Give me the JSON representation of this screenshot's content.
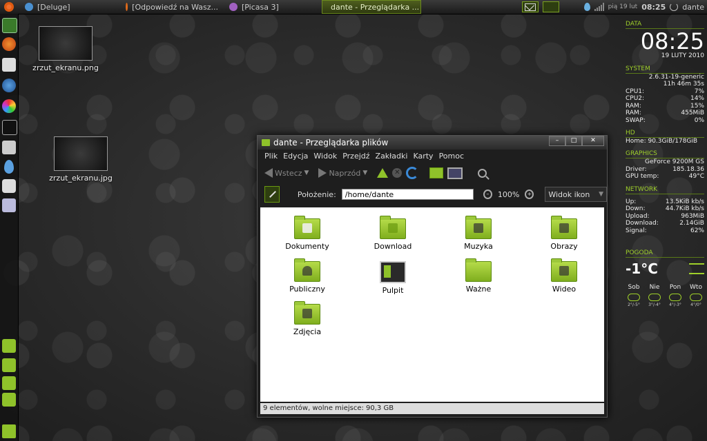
{
  "top_panel": {
    "tasks": [
      {
        "label": "[Deluge]"
      },
      {
        "label": "[Odpowiedź na Wasz..."
      },
      {
        "label": "[Picasa 3]"
      },
      {
        "label": "dante - Przeglądarka ..."
      }
    ],
    "clock_day": "pią 19 lut",
    "clock_time": "08:25",
    "user": "dante"
  },
  "desktop_icons": [
    {
      "label": "zrzut_ekranu.png"
    },
    {
      "label": "zrzut_ekranu.jpg"
    }
  ],
  "conky": {
    "date_head": "DATA",
    "time": "08:25",
    "date": "19 LUTY 2010",
    "system_head": "SYSTEM",
    "kernel": "2.6.31-19-generic",
    "uptime": "11h 46m 35s",
    "system_rows": [
      {
        "k": "CPU1:",
        "v": "7%"
      },
      {
        "k": "CPU2:",
        "v": "14%"
      },
      {
        "k": "RAM:",
        "v": "15%"
      },
      {
        "k": "RAM:",
        "v": "455MiB"
      },
      {
        "k": "SWAP:",
        "v": "0%"
      }
    ],
    "hd_head": "HD",
    "hd_home": "Home: 90.3GiB/178GiB",
    "graphics_head": "GRAPHICS",
    "gpu": "GeForce 9200M GS",
    "graphics_rows": [
      {
        "k": "Driver:",
        "v": "185.18.36"
      },
      {
        "k": "GPU temp:",
        "v": "49°C"
      }
    ],
    "network_head": "NETWORK",
    "network_rows": [
      {
        "k": "Up:",
        "v": "13.5KiB kb/s"
      },
      {
        "k": "Down:",
        "v": "44.7KiB kb/s"
      },
      {
        "k": "Upload:",
        "v": "963MiB"
      },
      {
        "k": "Download:",
        "v": "2.14GiB"
      },
      {
        "k": "Signal:",
        "v": "62%"
      }
    ],
    "weather_head": "POGODA",
    "temperature": "-1°C",
    "days": [
      {
        "name": "Sob",
        "range": "2°/-5°"
      },
      {
        "name": "Nie",
        "range": "3°/-4°"
      },
      {
        "name": "Pon",
        "range": "4°/-3°"
      },
      {
        "name": "Wto",
        "range": "4°/0°"
      }
    ]
  },
  "window": {
    "title": "dante - Przeglądarka plików",
    "menu": [
      "Plik",
      "Edycja",
      "Widok",
      "Przejdź",
      "Zakładki",
      "Karty",
      "Pomoc"
    ],
    "back_label": "Wstecz",
    "forward_label": "Naprzód",
    "location_label": "Położenie:",
    "path": "/home/dante",
    "zoom": "100%",
    "view_mode": "Widok ikon",
    "folders": [
      {
        "label": "Dokumenty"
      },
      {
        "label": "Download"
      },
      {
        "label": "Muzyka"
      },
      {
        "label": "Obrazy"
      },
      {
        "label": "Publiczny"
      },
      {
        "label": "Pulpit"
      },
      {
        "label": "Ważne"
      },
      {
        "label": "Wideo"
      },
      {
        "label": "Zdjęcia"
      }
    ],
    "status": "9 elementów, wolne miejsce: 90,3 GB"
  }
}
